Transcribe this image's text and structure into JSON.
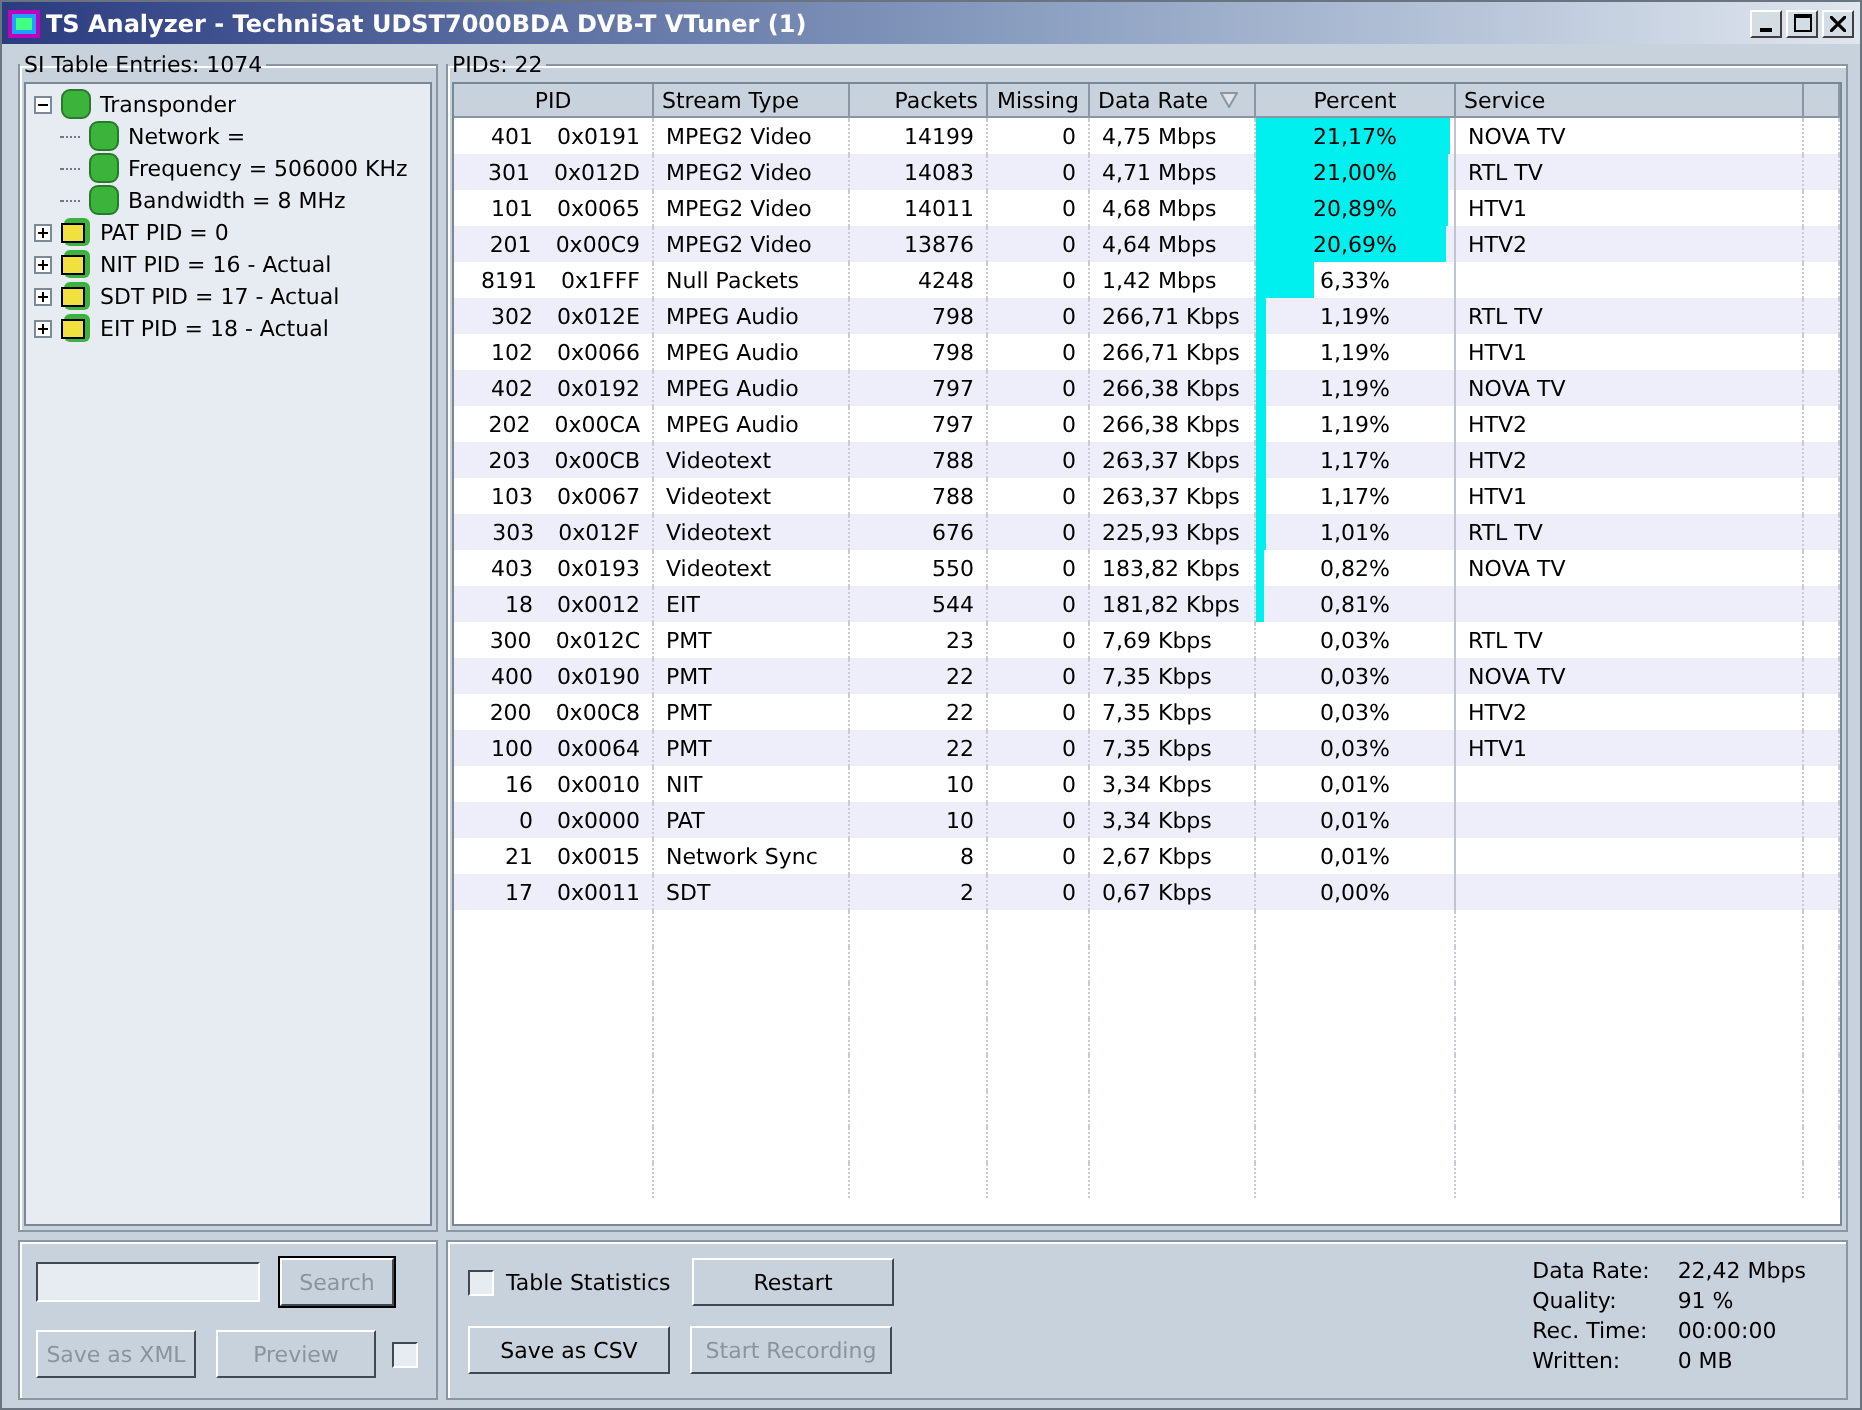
{
  "window": {
    "title": "TS Analyzer - TechniSat UDST7000BDA DVB-T VTuner (1)"
  },
  "si_panel": {
    "title": "SI Table Entries: 1074",
    "tree": [
      {
        "label": "Transponder",
        "kind": "entry",
        "expanded": true,
        "children": [
          {
            "label": "Network =",
            "kind": "entry"
          },
          {
            "label": "Frequency = 506000 KHz",
            "kind": "entry"
          },
          {
            "label": "Bandwidth = 8 MHz",
            "kind": "entry"
          }
        ]
      },
      {
        "label": "PAT PID = 0",
        "kind": "table",
        "expanded": false
      },
      {
        "label": "NIT PID = 16 - Actual",
        "kind": "table",
        "expanded": false
      },
      {
        "label": "SDT PID = 17 - Actual",
        "kind": "table",
        "expanded": false
      },
      {
        "label": "EIT PID = 18 - Actual",
        "kind": "table",
        "expanded": false
      }
    ],
    "buttons": [
      {
        "label": "Search",
        "disabled": true,
        "default": true
      },
      {
        "label": "Save as XML",
        "disabled": true,
        "default": false
      },
      {
        "label": "Preview",
        "disabled": true,
        "default": false
      }
    ],
    "side_checkbox": {
      "checked": false
    }
  },
  "pids_panel": {
    "title": "PIDs: 22",
    "columns": [
      {
        "label": "PID",
        "sorted": false
      },
      {
        "label": "Stream Type",
        "sorted": false
      },
      {
        "label": "Packets",
        "sorted": false
      },
      {
        "label": "Missing",
        "sorted": false
      },
      {
        "label": "Data Rate",
        "sorted": true
      },
      {
        "label": "Percent",
        "sorted": false
      },
      {
        "label": "Service",
        "sorted": false
      }
    ],
    "rows": [
      {
        "pid": "401",
        "hex": "0x0191",
        "type": "MPEG2 Video",
        "packets": "14199",
        "missing": "0",
        "rate": "4,75 Mbps",
        "percent": "21,17%",
        "level": 0.98,
        "service": "NOVA TV"
      },
      {
        "pid": "301",
        "hex": "0x012D",
        "type": "MPEG2 Video",
        "packets": "14083",
        "missing": "0",
        "rate": "4,71 Mbps",
        "percent": "21,00%",
        "level": 0.97,
        "service": "RTL TV"
      },
      {
        "pid": "101",
        "hex": "0x0065",
        "type": "MPEG2 Video",
        "packets": "14011",
        "missing": "0",
        "rate": "4,68 Mbps",
        "percent": "20,89%",
        "level": 0.97,
        "service": "HTV1"
      },
      {
        "pid": "201",
        "hex": "0x00C9",
        "type": "MPEG2 Video",
        "packets": "13876",
        "missing": "0",
        "rate": "4,64 Mbps",
        "percent": "20,69%",
        "level": 0.96,
        "service": "HTV2"
      },
      {
        "pid": "8191",
        "hex": "0x1FFF",
        "type": "Null Packets",
        "packets": "4248",
        "missing": "0",
        "rate": "1,42 Mbps",
        "percent": "6,33%",
        "level": 0.29
      },
      {
        "pid": "302",
        "hex": "0x012E",
        "type": "MPEG Audio",
        "packets": "798",
        "missing": "0",
        "rate": "266,71 Kbps",
        "percent": "1,19%",
        "level": 0.055,
        "service": "RTL TV"
      },
      {
        "pid": "102",
        "hex": "0x0066",
        "type": "MPEG Audio",
        "packets": "798",
        "missing": "0",
        "rate": "266,71 Kbps",
        "percent": "1,19%",
        "level": 0.055,
        "service": "HTV1"
      },
      {
        "pid": "402",
        "hex": "0x0192",
        "type": "MPEG Audio",
        "packets": "797",
        "missing": "0",
        "rate": "266,38 Kbps",
        "percent": "1,19%",
        "level": 0.055,
        "service": "NOVA TV"
      },
      {
        "pid": "202",
        "hex": "0x00CA",
        "type": "MPEG Audio",
        "packets": "797",
        "missing": "0",
        "rate": "266,38 Kbps",
        "percent": "1,19%",
        "level": 0.055,
        "service": "HTV2"
      },
      {
        "pid": "203",
        "hex": "0x00CB",
        "type": "Videotext",
        "packets": "788",
        "missing": "0",
        "rate": "263,37 Kbps",
        "percent": "1,17%",
        "level": 0.054,
        "service": "HTV2"
      },
      {
        "pid": "103",
        "hex": "0x0067",
        "type": "Videotext",
        "packets": "788",
        "missing": "0",
        "rate": "263,37 Kbps",
        "percent": "1,17%",
        "level": 0.054,
        "service": "HTV1"
      },
      {
        "pid": "303",
        "hex": "0x012F",
        "type": "Videotext",
        "packets": "676",
        "missing": "0",
        "rate": "225,93 Kbps",
        "percent": "1,01%",
        "level": 0.047,
        "service": "RTL TV"
      },
      {
        "pid": "403",
        "hex": "0x0193",
        "type": "Videotext",
        "packets": "550",
        "missing": "0",
        "rate": "183,82 Kbps",
        "percent": "0,82%",
        "level": 0.038,
        "service": "NOVA TV"
      },
      {
        "pid": "18",
        "hex": "0x0012",
        "type": "EIT",
        "packets": "544",
        "missing": "0",
        "rate": "181,82 Kbps",
        "percent": "0,81%",
        "level": 0.037
      },
      {
        "pid": "300",
        "hex": "0x012C",
        "type": "PMT",
        "packets": "23",
        "missing": "0",
        "rate": "7,69 Kbps",
        "percent": "0,03%",
        "service": "RTL TV"
      },
      {
        "pid": "400",
        "hex": "0x0190",
        "type": "PMT",
        "packets": "22",
        "missing": "0",
        "rate": "7,35 Kbps",
        "percent": "0,03%",
        "service": "NOVA TV"
      },
      {
        "pid": "200",
        "hex": "0x00C8",
        "type": "PMT",
        "packets": "22",
        "missing": "0",
        "rate": "7,35 Kbps",
        "percent": "0,03%",
        "service": "HTV2"
      },
      {
        "pid": "100",
        "hex": "0x0064",
        "type": "PMT",
        "packets": "22",
        "missing": "0",
        "rate": "7,35 Kbps",
        "percent": "0,03%",
        "service": "HTV1"
      },
      {
        "pid": "16",
        "hex": "0x0010",
        "type": "NIT",
        "packets": "10",
        "missing": "0",
        "rate": "3,34 Kbps",
        "percent": "0,01%"
      },
      {
        "pid": "0",
        "hex": "0x0000",
        "type": "PAT",
        "packets": "10",
        "missing": "0",
        "rate": "3,34 Kbps",
        "percent": "0,01%"
      },
      {
        "pid": "21",
        "hex": "0x0015",
        "type": "Network Sync",
        "packets": "8",
        "missing": "0",
        "rate": "2,67 Kbps",
        "percent": "0,01%"
      },
      {
        "pid": "17",
        "hex": "0x0011",
        "type": "SDT",
        "packets": "2",
        "missing": "0",
        "rate": "0,67 Kbps",
        "percent": "0,00%"
      }
    ],
    "table_statistics": {
      "label": "Table Statistics",
      "checked": false
    },
    "buttons": [
      {
        "label": "Restart",
        "disabled": false
      },
      {
        "label": "Save as CSV",
        "disabled": false
      },
      {
        "label": "Start Recording",
        "disabled": true
      }
    ],
    "stats": [
      {
        "label": "Data Rate:",
        "value": "22,42 Mbps"
      },
      {
        "label": "Quality:",
        "value": "91 %"
      },
      {
        "label": "Rec. Time:",
        "value": "00:00:00"
      },
      {
        "label": "Written:",
        "value": "0 MB"
      }
    ]
  }
}
